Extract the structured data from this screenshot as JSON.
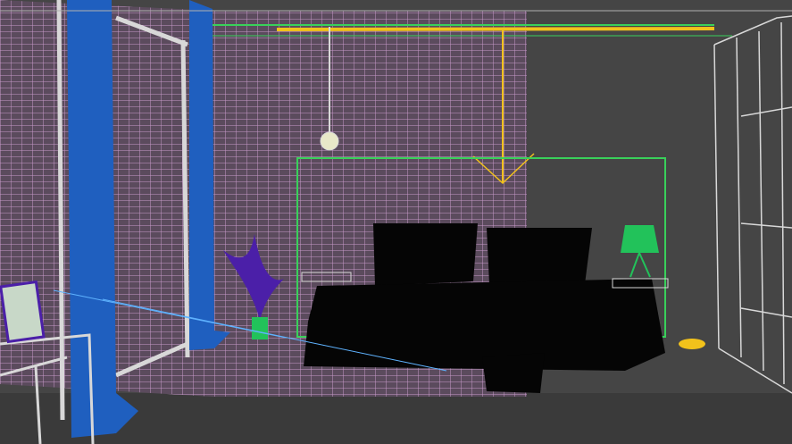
{
  "viewport": {
    "colors": {
      "background": "#454545",
      "floor": "#3a3a3a",
      "wall_fill": "#5b4b5d",
      "wall_grid": "#c79ac9",
      "curtain": "#1f5fbf",
      "bed": "#050505",
      "lamp": "#22c25a",
      "plant": "#4b1fa8",
      "light_line": "#f2c21b",
      "green_line": "#39d05a",
      "wire_white": "#d8d8d8"
    }
  }
}
